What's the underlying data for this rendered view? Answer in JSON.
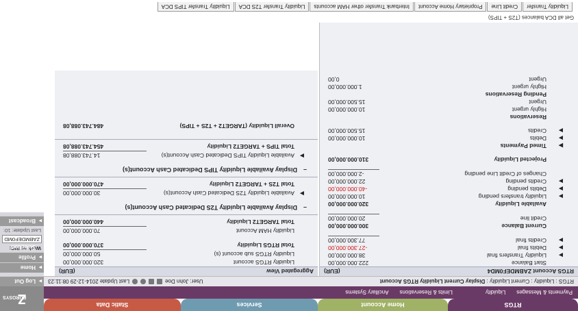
{
  "nav": {
    "tabs": [
      "RTGS",
      "Home Account",
      "Services",
      "Static Data"
    ],
    "sub_items": [
      "Payments & Messages",
      "Liquidity",
      "Limits & Reservations",
      "Ancillary Systems"
    ],
    "logo_text": "Z",
    "logo_small": "EUROSYS"
  },
  "status": {
    "crumb_prefix": "RTGS : Liquidity : Current Liquidity :",
    "crumb_current": "Display Current Liquidity RTGS Account",
    "user": "User: John Doe",
    "last_update": "Last Update 2014-12-29 08:11:23"
  },
  "side": {
    "log_out": "Log Out",
    "home": "Home",
    "profile": "Profile Selection",
    "work_as": "Work as BIC:",
    "bic_value": "ZABMDEF0MD",
    "last_update": "Last Update: 10:",
    "broadcast": "Broadcast"
  },
  "left": {
    "header_title": "RTGS Account ZABMDEF0MD4",
    "header_unit": "(EUR)",
    "start_balance_label": "Start Balance",
    "start_balance": "222.000.000,00",
    "liq_final_label": "Liquidity Transfers final",
    "liq_final": "38.000.000,00",
    "debits_final_label": "Debits final",
    "debits_final": "-27.300.000,00",
    "credits_final_label": "Credits final",
    "credits_final": "77.300.000,00",
    "current_balance_label": "Current Balance",
    "current_balance": "300.000.000,00",
    "credit_line_label": "Credit line",
    "credit_line": "20.000.000,00",
    "available_label": "Available Liquidity",
    "available": "320.000.000,00",
    "liq_pending_label": "Liquidity transfers pending",
    "liq_pending": "10.000.000,00",
    "debits_pending_label": "Debits pending",
    "debits_pending": "-40.000.000,00",
    "credits_pending_label": "Credits pending",
    "credits_pending": "22.000.000,00",
    "ccl_pending_label": "Changes of Credit Line pending",
    "ccl_pending": "-2.000.000,00",
    "projected_label": "Projected Liquidity",
    "projected": "310.000.000,00",
    "timed_label": "Timed Payments",
    "debits_label": "Debits",
    "debits": "10.000.000,00",
    "credits_label": "Credits",
    "credits": "15.500.000,00",
    "reservations_label": "Reservations",
    "res_high_label": "Highly urgent",
    "res_high": "10.000.000,00",
    "res_urgent_label": "Urgent",
    "res_urgent": "15.500.000,00",
    "pending_res_label": "Pending Reservations",
    "pres_high_label": "Highly urgent",
    "pres_high": "1.000.000,00",
    "pres_urgent_label": "Urgent",
    "pres_urgent": "0,00"
  },
  "right": {
    "header_title": "Aggregated View",
    "header_unit": "(EUR)",
    "rtgs_account_label": "Liquidity RTGS account",
    "rtgs_account": "320.000.000,00",
    "rtgs_sub_label": "Liquidity RTGS sub account (s)",
    "rtgs_sub": "50.000.000,00",
    "total_rtgs_label": "Total RTGS Liquidity",
    "total_rtgs": "370.000.000,00",
    "ham_label": "Liquidity HAM Account",
    "ham": "70.000.000,00",
    "total_t2_label": "Total TARGET2 Liquidity",
    "total_t2": "440.000.000,00",
    "t2s_section": "Display Available Liquidity T2S Dedicated Cash Account(s)",
    "t2s_avail_label": "Available Liquidity T2S Dedicated Cash Account(s)",
    "t2s_avail": "30.000.000,00",
    "total_t2s_label": "Total T2S + TARGET2 Liquidity",
    "total_t2s": "470.000.000,00",
    "tips_section": "Display Available Liquidity TIPS Dedicated Cash Account(s)",
    "tips_avail_label": "Available Liquidity TIPS Dedicated Cash Account(s)",
    "tips_avail": "14.743.088,08",
    "total_tips_label": "Total TIPS + TARGET2 Liquidity",
    "total_tips": "454.743.088,08",
    "overall_label": "Overall Liquidity (TARGET2 + T2S + TIPS)",
    "overall": "484.743.088,08"
  },
  "tabs": {
    "items": [
      "Liquidity Transfer",
      "Credit Line",
      "Proprietary Home Account",
      "Interbank Transfer other HAM accounts",
      "Liquidity Transfer T2S DCA",
      "Liquidity Transfer TIPS DCA"
    ],
    "dca_line": "Get all DCA balances (T2S + TIPS)"
  }
}
